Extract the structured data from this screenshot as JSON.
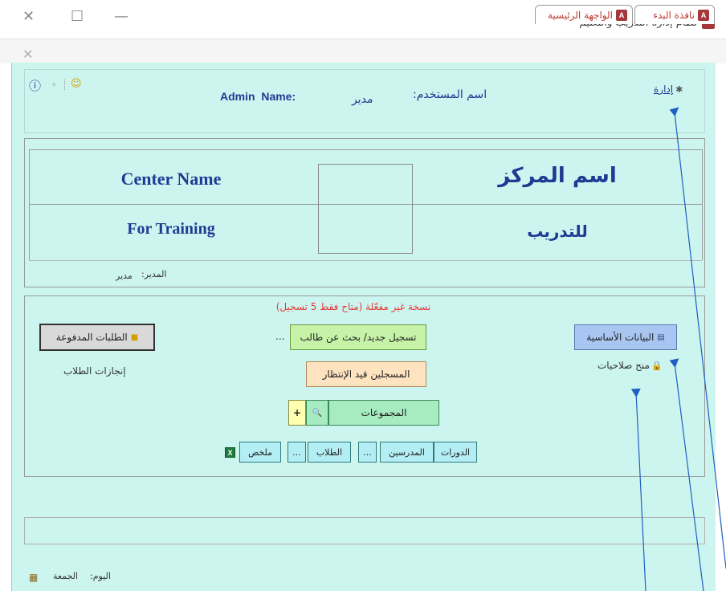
{
  "window": {
    "title": "نظام إدارة التدريب والتعليم",
    "app_icon": "A",
    "controls": {
      "close": "✕",
      "maximize": "☐",
      "minimize": "—"
    }
  },
  "tabs": [
    {
      "label": "نافذة البدء",
      "icon": "A"
    },
    {
      "label": "الواجهة الرئيسية",
      "icon": "A"
    }
  ],
  "tab_close": "✕",
  "header": {
    "admin_link": "إدارة",
    "user_label": "اسم المستخدم:",
    "user_value": "مدير",
    "admin_name_label": "Admin  Name:",
    "info_icon": "ⓘ",
    "small_icon": "◦",
    "face_icon": "☺"
  },
  "center": {
    "name_ar": "اسم المركز",
    "name_en": "Center Name",
    "training_ar": "للتدريب",
    "training_en": "For Training",
    "manager_label": "المدير:",
    "manager_value": "مدير"
  },
  "main": {
    "notice": "نسخة غير مفعّلة (متاح فقط 5 تسجيل)",
    "basic_data": "البيانات الأساسية",
    "permissions": "منح صلاحيات",
    "register_search": "تسجيل جديد/ بحث عن طالب",
    "ellipsis": "...",
    "waiting": "المسجلين قيد الإنتظار",
    "groups": "المجموعات",
    "plus": "+",
    "binoculars": "🔍",
    "courses": "الدورات",
    "teachers": "المدرسين",
    "students": "الطلاب",
    "summary": "ملخص",
    "excel": "X",
    "paid_requests": "الطلبات المدفوعة",
    "achievements": "إنجازات الطلاب"
  },
  "footer": {
    "day_label": "اليوم:",
    "day_value": "الجمعة"
  },
  "colors": {
    "form_bg": "#ccf5f0",
    "title_blue": "#1f3a93",
    "notice_red": "#e53935",
    "btn_blue": "#a9c6f2",
    "btn_green": "#c6f3a8",
    "btn_peach": "#fde3bf",
    "btn_mint": "#a6ecc0",
    "btn_cyan": "#b3eef4",
    "btn_gray": "#d9d9d9",
    "arrow": "#1f5fc1"
  }
}
